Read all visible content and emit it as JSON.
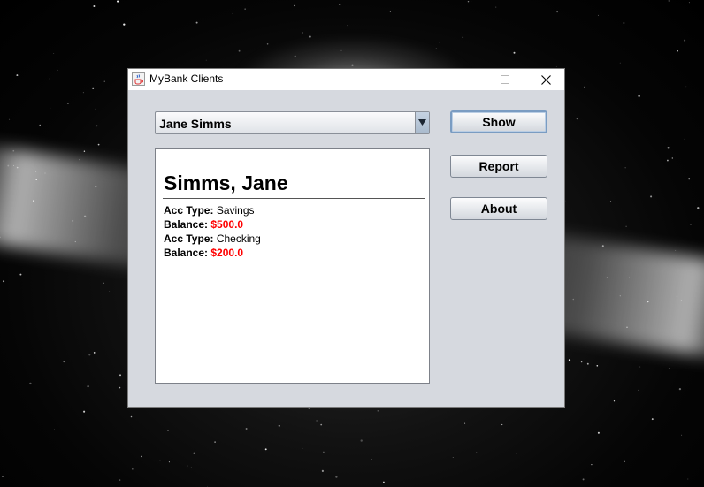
{
  "window": {
    "title": "MyBank Clients",
    "icon": "java-cup-icon",
    "controls": {
      "minimize_icon": "minimize-icon",
      "maximize_icon": "maximize-icon",
      "close_icon": "close-icon"
    }
  },
  "client_selector": {
    "selected_value": "Jane Simms",
    "arrow_icon": "chevron-down-icon"
  },
  "detail": {
    "heading": "Simms, Jane",
    "accounts": [
      {
        "type_label": "Acc Type:",
        "type_value": "Savings",
        "balance_label": "Balance:",
        "balance_value": "$500.0"
      },
      {
        "type_label": "Acc Type:",
        "type_value": "Checking",
        "balance_label": "Balance:",
        "balance_value": "$200.0"
      }
    ]
  },
  "buttons": {
    "show": "Show",
    "report": "Report",
    "about": "About"
  },
  "colors": {
    "balance": "#ff0000",
    "window_background": "#d6d9df",
    "focus_border": "#7a9cc2"
  }
}
